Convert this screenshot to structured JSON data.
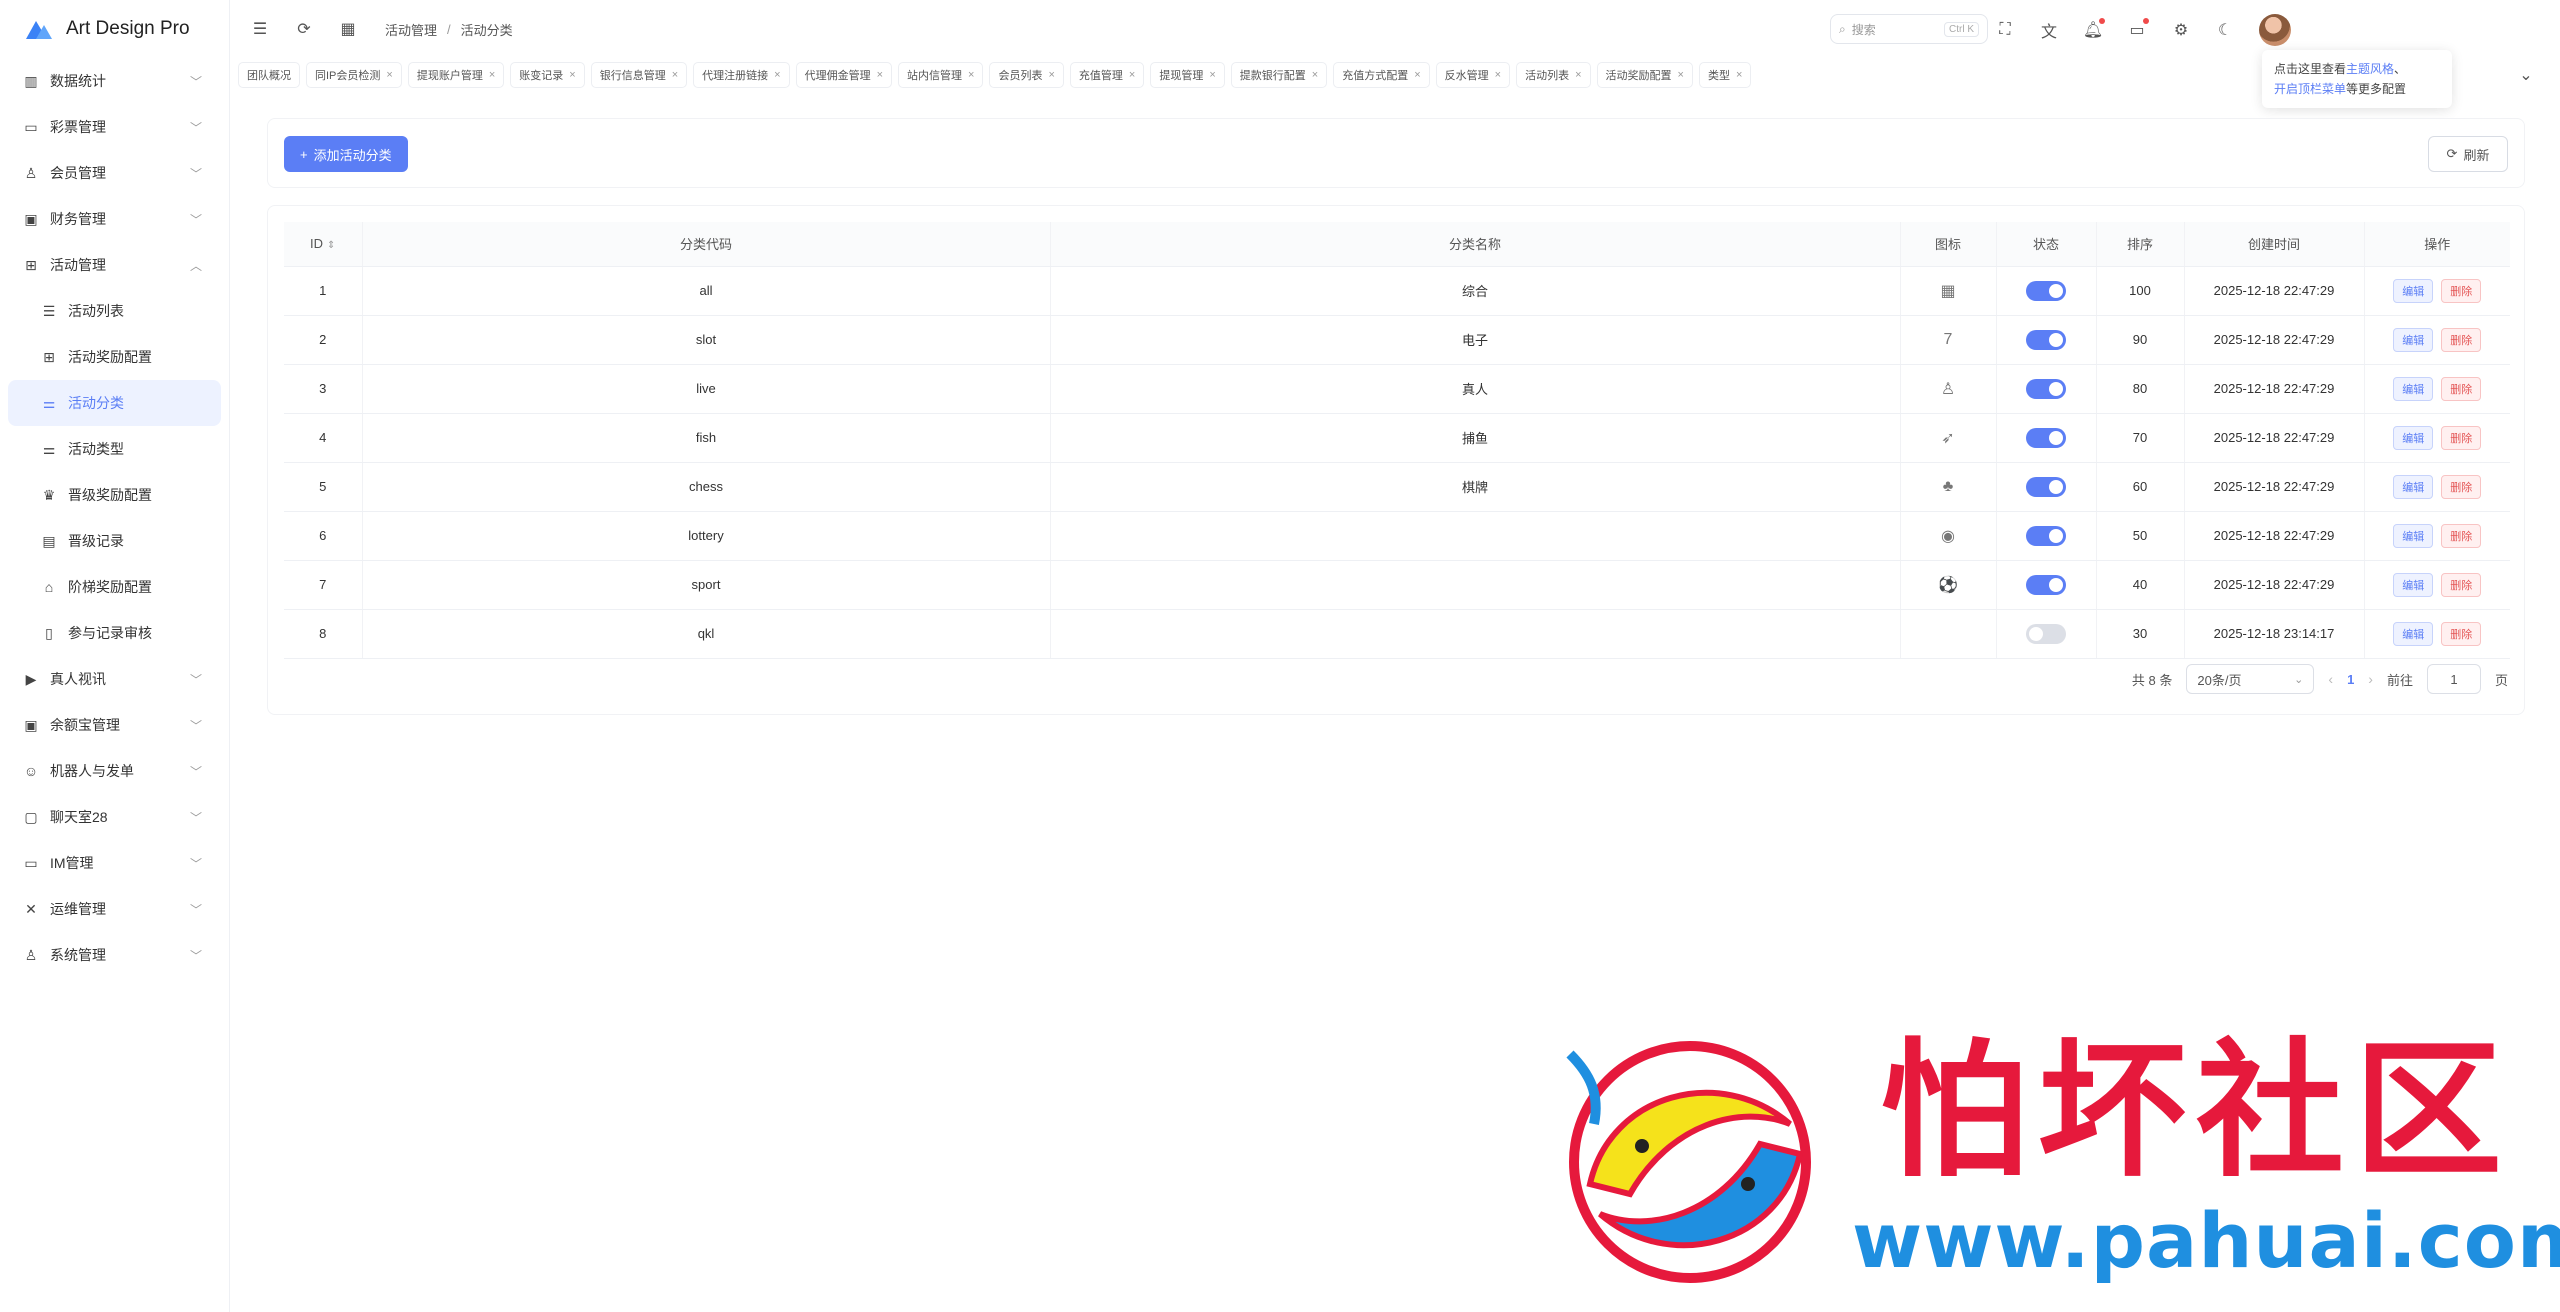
{
  "app": {
    "title": "Art Design Pro"
  },
  "sidebar": {
    "items": [
      {
        "label": "数据统计",
        "icon": "chart-icon"
      },
      {
        "label": "彩票管理",
        "icon": "ticket-icon"
      },
      {
        "label": "会员管理",
        "icon": "user-icon"
      },
      {
        "label": "财务管理",
        "icon": "wallet-icon"
      },
      {
        "label": "活动管理",
        "icon": "gift-icon"
      }
    ],
    "sub_items": [
      {
        "label": "活动列表",
        "icon": "list-icon"
      },
      {
        "label": "活动奖励配置",
        "icon": "gift-icon"
      },
      {
        "label": "活动分类",
        "icon": "category-icon"
      },
      {
        "label": "活动类型",
        "icon": "category-icon"
      },
      {
        "label": "晋级奖励配置",
        "icon": "crown-icon"
      },
      {
        "label": "晋级记录",
        "icon": "document-icon"
      },
      {
        "label": "阶梯奖励配置",
        "icon": "map-icon"
      },
      {
        "label": "参与记录审核",
        "icon": "document-check-icon"
      }
    ],
    "items_after": [
      {
        "label": "真人视讯",
        "icon": "video-icon"
      },
      {
        "label": "余额宝管理",
        "icon": "safe-icon"
      },
      {
        "label": "机器人与发单",
        "icon": "robot-icon"
      },
      {
        "label": "聊天室28",
        "icon": "chat-icon"
      },
      {
        "label": "IM管理",
        "icon": "message-icon"
      },
      {
        "label": "运维管理",
        "icon": "tools-icon"
      },
      {
        "label": "系统管理",
        "icon": "user-icon"
      }
    ]
  },
  "topbar": {
    "breadcrumb": [
      "活动管理",
      "活动分类"
    ],
    "breadcrumb_sep": "/",
    "search_placeholder": "搜索",
    "search_shortcut": "Ctrl K"
  },
  "tabs": [
    "团队概况",
    "同IP会员检测",
    "提现账户管理",
    "账变记录",
    "银行信息管理",
    "代理注册链接",
    "代理佣金管理",
    "站内信管理",
    "会员列表",
    "充值管理",
    "提现管理",
    "提款银行配置",
    "充值方式配置",
    "反水管理",
    "活动列表",
    "活动奖励配置",
    "类型"
  ],
  "tooltip": {
    "line1_prefix": "点击这里查看",
    "line1_link": "主题风格",
    "line1_suffix": "、",
    "line2_link": "开启顶栏菜单",
    "line2_suffix": "等更多配置"
  },
  "toolbar": {
    "add_label": "添加活动分类",
    "add_icon": "+",
    "refresh_label": "刷新"
  },
  "table": {
    "columns": [
      "ID",
      "分类代码",
      "分类名称",
      "图标",
      "状态",
      "排序",
      "创建时间",
      "操作"
    ],
    "edit_label": "编辑",
    "delete_label": "删除",
    "rows": [
      {
        "id": "1",
        "code": "all",
        "name": "综合",
        "icon": "▦",
        "enabled": true,
        "sort": "100",
        "created": "2025-12-18 22:47:29"
      },
      {
        "id": "2",
        "code": "slot",
        "name": "电子",
        "icon": "7",
        "enabled": true,
        "sort": "90",
        "created": "2025-12-18 22:47:29"
      },
      {
        "id": "3",
        "code": "live",
        "name": "真人",
        "icon": "♙",
        "enabled": true,
        "sort": "80",
        "created": "2025-12-18 22:47:29"
      },
      {
        "id": "4",
        "code": "fish",
        "name": "捕鱼",
        "icon": "➶",
        "enabled": true,
        "sort": "70",
        "created": "2025-12-18 22:47:29"
      },
      {
        "id": "5",
        "code": "chess",
        "name": "棋牌",
        "icon": "♣",
        "enabled": true,
        "sort": "60",
        "created": "2025-12-18 22:47:29"
      },
      {
        "id": "6",
        "code": "lottery",
        "name": "",
        "icon": "◉",
        "enabled": true,
        "sort": "50",
        "created": "2025-12-18 22:47:29"
      },
      {
        "id": "7",
        "code": "sport",
        "name": "",
        "icon": "⚽",
        "enabled": true,
        "sort": "40",
        "created": "2025-12-18 22:47:29"
      },
      {
        "id": "8",
        "code": "qkl",
        "name": "",
        "icon": "",
        "enabled": false,
        "sort": "30",
        "created": "2025-12-18 23:14:17"
      }
    ]
  },
  "pagination": {
    "total_label": "共 8 条",
    "page_size": "20条/页",
    "current_page": "1",
    "goto_label": "前往",
    "goto_value": "1",
    "page_suffix": "页"
  },
  "watermark": {
    "title": "怕坏社区",
    "url": "www.pahuai.com"
  },
  "colors": {
    "accent": "#5b7ef5",
    "danger": "#e45656",
    "watermark_red": "#e6193c",
    "watermark_blue": "#1f8fe0"
  }
}
